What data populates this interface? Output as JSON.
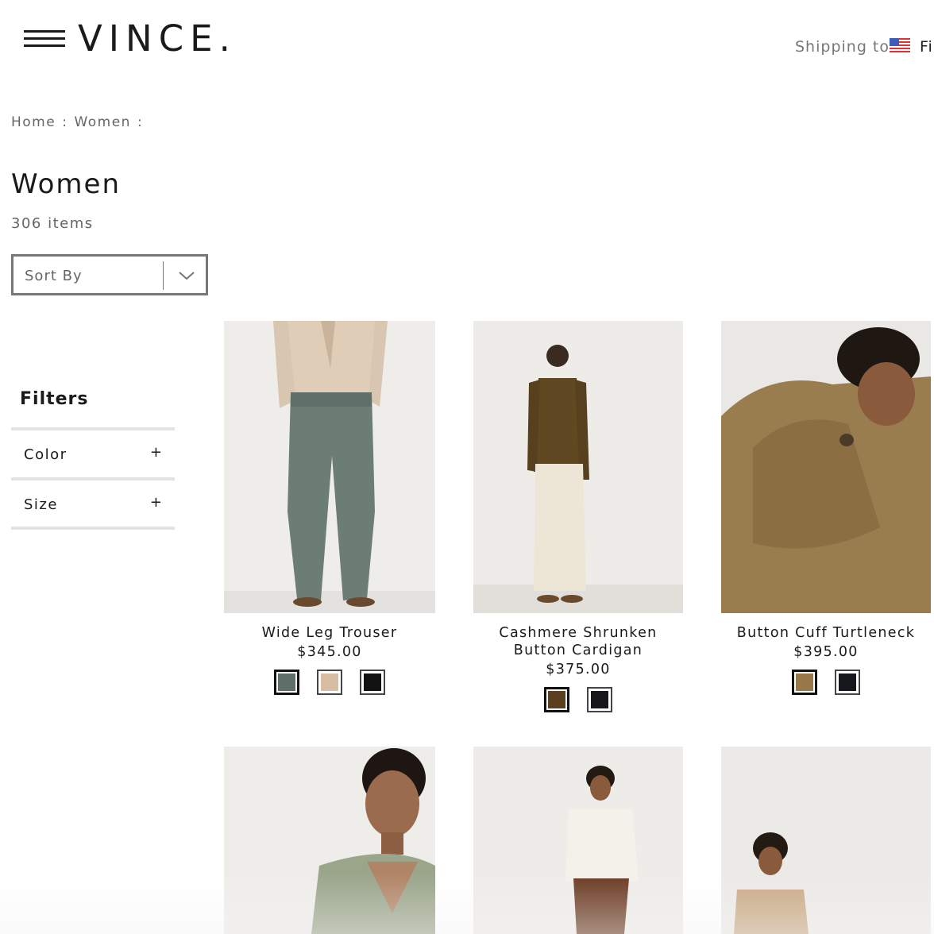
{
  "header": {
    "logo": "VINCE.",
    "shipping_label": "Shipping to",
    "locale_fragment": "Fi"
  },
  "breadcrumb": {
    "items": [
      "Home",
      "Women"
    ],
    "separator": ":"
  },
  "page": {
    "title": "Women",
    "item_count": "306 items"
  },
  "sort": {
    "label": "Sort By"
  },
  "filters": {
    "title": "Filters",
    "groups": [
      {
        "label": "Color",
        "toggle": "+"
      },
      {
        "label": "Size",
        "toggle": "+"
      }
    ]
  },
  "products": [
    {
      "name": "Wide Leg Trouser",
      "price": "$345.00",
      "swatches": [
        "#5f6e68",
        "#d8bda5",
        "#121212"
      ]
    },
    {
      "name": "Cashmere Shrunken Button Cardigan",
      "price": "$375.00",
      "swatches": [
        "#5a4020",
        "#16181c"
      ]
    },
    {
      "name": "Button Cuff Turtleneck",
      "price": "$395.00",
      "swatches": [
        "#96784b",
        "#15171a"
      ]
    },
    {
      "name": "",
      "price": "",
      "swatches": []
    },
    {
      "name": "",
      "price": "",
      "swatches": []
    },
    {
      "name": "",
      "price": "",
      "swatches": []
    }
  ],
  "colors": {
    "text": "#1a1a1a",
    "muted": "#666666",
    "border": "#777777",
    "divider": "#e3e3e3"
  }
}
